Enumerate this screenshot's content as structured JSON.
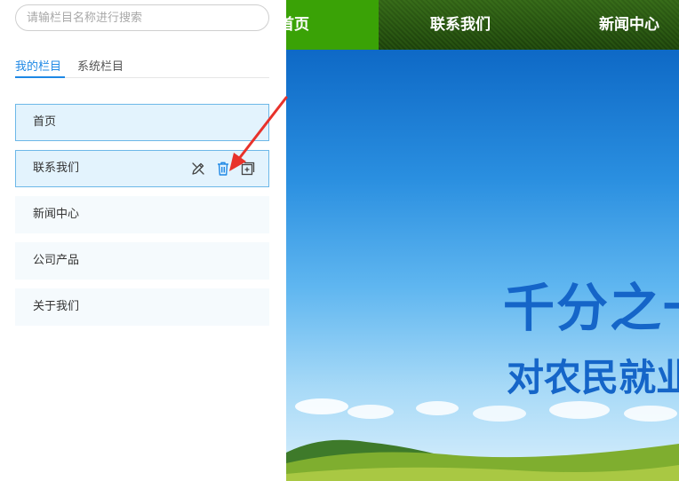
{
  "search": {
    "placeholder": "请输栏目名称进行搜索"
  },
  "tabs": [
    {
      "label": "我的栏目",
      "active": true
    },
    {
      "label": "系统栏目",
      "active": false
    }
  ],
  "columns": [
    {
      "label": "首页"
    },
    {
      "label": "联系我们",
      "actions": [
        "edit-icon",
        "trash-icon",
        "add-subcolumn-icon"
      ]
    },
    {
      "label": "新闻中心"
    },
    {
      "label": "公司产品"
    },
    {
      "label": "关于我们"
    }
  ],
  "preview": {
    "nav": [
      {
        "label": "首页"
      },
      {
        "label": "联系我们"
      },
      {
        "label": "新闻中心"
      }
    ],
    "banner": {
      "headline": "千分之一",
      "subline": "对农民就业"
    }
  },
  "colors": {
    "accent": "#1e88e5",
    "nav_active": "#3aa206",
    "banner_text": "#1565c8",
    "annotation_arrow": "#e8322b"
  }
}
